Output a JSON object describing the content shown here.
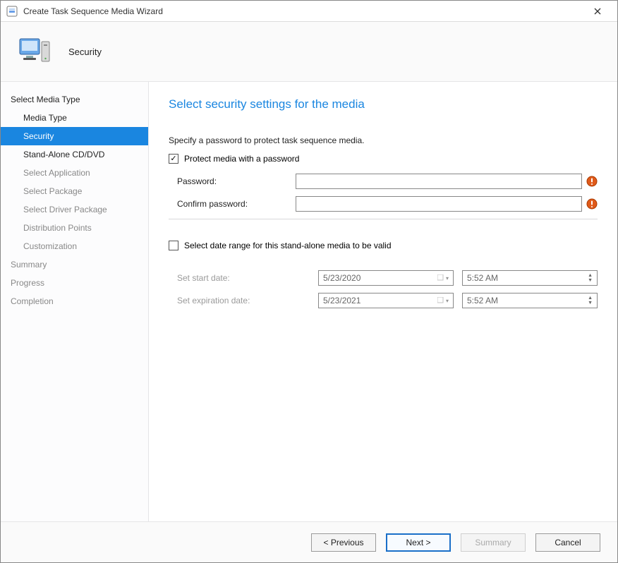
{
  "titlebar": {
    "title": "Create Task Sequence Media Wizard"
  },
  "header": {
    "page_name": "Security"
  },
  "sidebar": {
    "items": [
      {
        "label": "Select Media Type",
        "sub": false,
        "disabled": false,
        "selected": false
      },
      {
        "label": "Media Type",
        "sub": true,
        "disabled": false,
        "selected": false
      },
      {
        "label": "Security",
        "sub": true,
        "disabled": false,
        "selected": true
      },
      {
        "label": "Stand-Alone CD/DVD",
        "sub": true,
        "disabled": false,
        "selected": false
      },
      {
        "label": "Select Application",
        "sub": true,
        "disabled": true,
        "selected": false
      },
      {
        "label": "Select Package",
        "sub": true,
        "disabled": true,
        "selected": false
      },
      {
        "label": "Select Driver Package",
        "sub": true,
        "disabled": true,
        "selected": false
      },
      {
        "label": "Distribution Points",
        "sub": true,
        "disabled": true,
        "selected": false
      },
      {
        "label": "Customization",
        "sub": true,
        "disabled": true,
        "selected": false
      },
      {
        "label": "Summary",
        "sub": false,
        "disabled": true,
        "selected": false
      },
      {
        "label": "Progress",
        "sub": false,
        "disabled": true,
        "selected": false
      },
      {
        "label": "Completion",
        "sub": false,
        "disabled": true,
        "selected": false
      }
    ]
  },
  "main": {
    "heading": "Select security settings for the media",
    "instruction": "Specify a password to protect task sequence media.",
    "protect_checkbox_label": "Protect media with a password",
    "protect_checked": true,
    "password_label": "Password:",
    "confirm_label": "Confirm password:",
    "date_checkbox_label": "Select date range for this stand-alone media to be valid",
    "date_checked": false,
    "start_label": "Set start date:",
    "expire_label": "Set expiration date:",
    "start_date": "5/23/2020",
    "start_time": "5:52 AM",
    "expire_date": "5/23/2021",
    "expire_time": "5:52 AM"
  },
  "footer": {
    "previous": "< Previous",
    "next": "Next >",
    "summary": "Summary",
    "cancel": "Cancel"
  }
}
